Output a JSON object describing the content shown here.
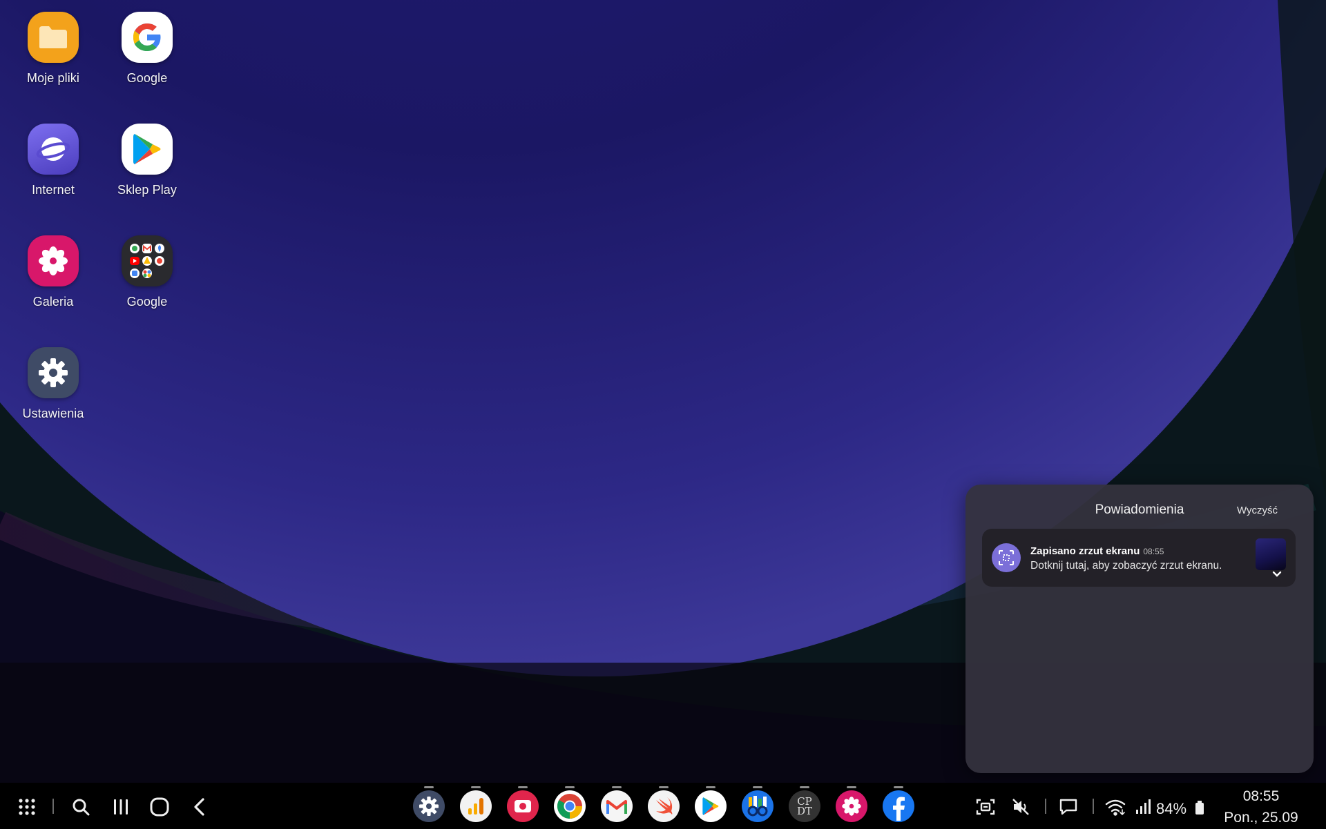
{
  "home_apps": [
    {
      "label": "Moje pliki",
      "icon": "folder-icon",
      "color": "#f3a21b"
    },
    {
      "label": "Google",
      "icon": "google-g-icon",
      "color": "#ffffff"
    },
    {
      "label": "Internet",
      "icon": "samsung-internet-icon",
      "color": "#6a5cd6"
    },
    {
      "label": "Sklep Play",
      "icon": "play-store-icon",
      "color": "#ffffff"
    },
    {
      "label": "Galeria",
      "icon": "gallery-flower-icon",
      "color": "#d8176a"
    },
    {
      "label": "Google",
      "icon": "google-folder-icon",
      "color": "#2a2a2e"
    },
    {
      "label": "Ustawienia",
      "icon": "settings-gear-icon",
      "color": "#3f4b66"
    }
  ],
  "notifications": {
    "title": "Powiadomienia",
    "clear_label": "Wyczyść",
    "items": [
      {
        "app_icon": "screenshot-icon",
        "title": "Zapisano zrzut ekranu",
        "time": "08:55",
        "text": "Dotknij tutaj, aby zobaczyć zrzut ekranu."
      }
    ]
  },
  "taskbar": {
    "nav": [
      "apps-grid-icon",
      "search-icon",
      "recents-icon",
      "home-icon",
      "back-icon"
    ],
    "dock": [
      "settings-icon",
      "analytics-icon",
      "screen-recorder-icon",
      "chrome-icon",
      "gmail-icon",
      "swift-icon",
      "play-store-icon",
      "news-icon",
      "cpdt-icon",
      "gallery-icon",
      "facebook-icon"
    ],
    "dock_text": {
      "cpdt": "CP\nDT"
    },
    "status": {
      "battery": "84%",
      "time": "08:55",
      "date": "Pon., 25.09"
    }
  }
}
